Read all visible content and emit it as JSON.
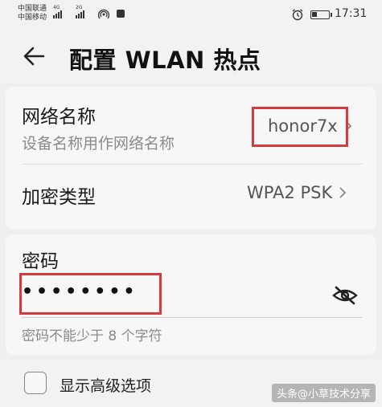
{
  "status_bar": {
    "carrier_1": "中国联通",
    "carrier_2": "中国移动",
    "net_1": "4G",
    "net_2": "2G",
    "time": "17:31"
  },
  "header": {
    "title": "配置 WLAN 热点"
  },
  "network_name": {
    "label": "网络名称",
    "hint": "设备名称用作网络名称",
    "value": "honor7x"
  },
  "encryption": {
    "label": "加密类型",
    "value": "WPA2 PSK"
  },
  "password": {
    "label": "密码",
    "value": "••••••••",
    "hint": "密码不能少于 8 个字符"
  },
  "advanced": {
    "label": "显示高级选项"
  },
  "watermark": "头条@小草技术分享",
  "colors": {
    "highlight": "#d43a40",
    "background": "#efefef",
    "card": "#f7f7f7"
  }
}
